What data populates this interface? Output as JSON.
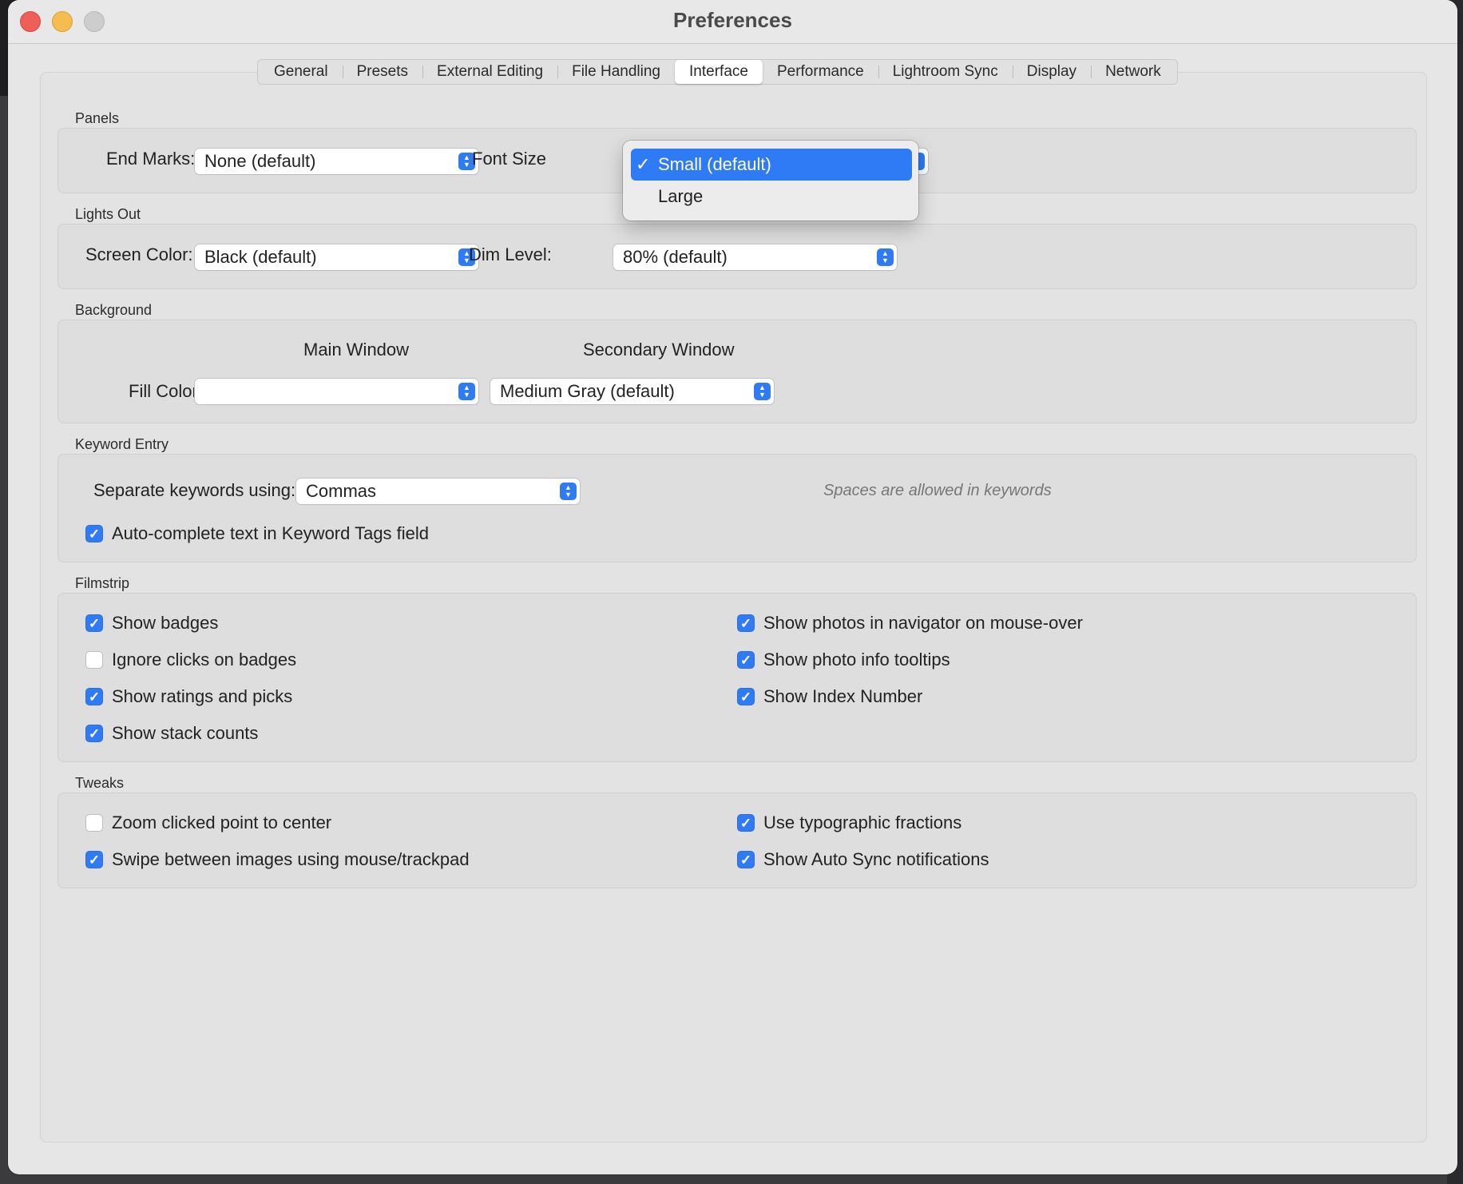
{
  "window": {
    "title": "Preferences"
  },
  "tabs": [
    "General",
    "Presets",
    "External Editing",
    "File Handling",
    "Interface",
    "Performance",
    "Lightroom Sync",
    "Display",
    "Network"
  ],
  "active_tab": "Interface",
  "panels": {
    "label": "Panels",
    "end_marks_label": "End Marks:",
    "end_marks_value": "None (default)",
    "font_size_label": "Font Size",
    "font_size_options": [
      {
        "label": "Small (default)",
        "selected": true,
        "check": "✓"
      },
      {
        "label": "Large",
        "selected": false
      }
    ]
  },
  "lights_out": {
    "label": "Lights Out",
    "screen_color_label": "Screen Color:",
    "screen_color_value": "Black (default)",
    "dim_level_label": "Dim Level:",
    "dim_level_value": "80% (default)"
  },
  "background": {
    "label": "Background",
    "main_window_label": "Main Window",
    "secondary_window_label": "Secondary Window",
    "fill_color_label": "Fill Color:",
    "main_fill_value": "",
    "secondary_fill_value": "Medium Gray (default)"
  },
  "keyword_entry": {
    "label": "Keyword Entry",
    "separate_label": "Separate keywords using:",
    "separate_value": "Commas",
    "hint": "Spaces are allowed in keywords",
    "autocomplete_label": "Auto-complete text in Keyword Tags field",
    "autocomplete_checked": true
  },
  "filmstrip": {
    "label": "Filmstrip",
    "left": [
      {
        "label": "Show badges",
        "checked": true
      },
      {
        "label": "Ignore clicks on badges",
        "checked": false
      },
      {
        "label": "Show ratings and picks",
        "checked": true
      },
      {
        "label": "Show stack counts",
        "checked": true
      }
    ],
    "right": [
      {
        "label": "Show photos in navigator on mouse-over",
        "checked": true
      },
      {
        "label": "Show photo info tooltips",
        "checked": true
      },
      {
        "label": "Show Index Number",
        "checked": true
      }
    ]
  },
  "tweaks": {
    "label": "Tweaks",
    "left": [
      {
        "label": "Zoom clicked point to center",
        "checked": false
      },
      {
        "label": "Swipe between images using mouse/trackpad",
        "checked": true
      }
    ],
    "right": [
      {
        "label": "Use typographic fractions",
        "checked": true
      },
      {
        "label": "Show Auto Sync notifications",
        "checked": true
      }
    ]
  },
  "colors": {
    "accent": "#2f7bf5",
    "window_bg": "#e6e6e6"
  }
}
